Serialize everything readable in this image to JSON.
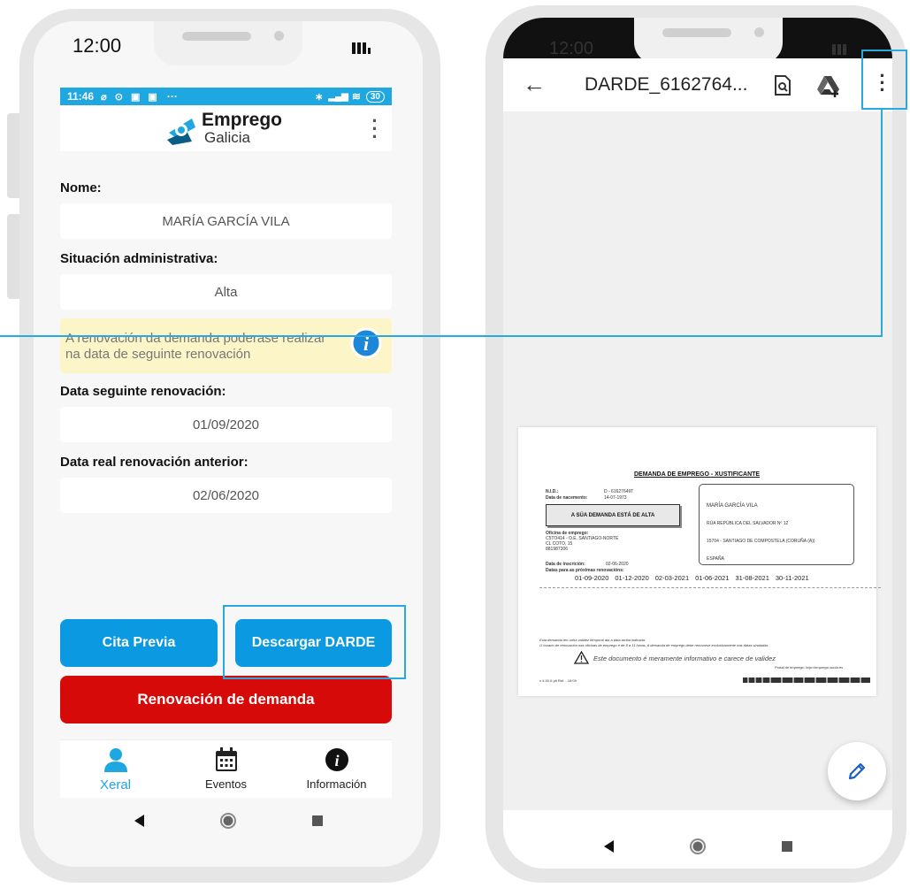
{
  "left": {
    "clock": "12:00",
    "status_bar": {
      "time": "11:46",
      "more": "···",
      "battery": "30"
    },
    "app": {
      "logo_line1": "Emprego",
      "logo_line2": "Galicia"
    },
    "fields": [
      {
        "label": "Nome:",
        "value": "MARÍA GARCÍA VILA"
      },
      {
        "label": "Situación administrativa:",
        "value": "Alta"
      },
      {
        "label": "Data seguinte renovación:",
        "value": "01/09/2020"
      },
      {
        "label": "Data real renovación anterior:",
        "value": "02/06/2020"
      }
    ],
    "info_message": "A renovación da demanda poderase realizar na data de seguinte renovación",
    "buttons": {
      "cita": "Cita Previa",
      "darde": "Descargar DARDE",
      "renovacion": "Renovación de demanda"
    },
    "nav": [
      {
        "label": "Xeral",
        "icon": "person-icon",
        "active": true
      },
      {
        "label": "Eventos",
        "icon": "calendar-icon",
        "active": false
      },
      {
        "label": "Información",
        "icon": "info-icon",
        "active": false
      }
    ]
  },
  "right": {
    "clock": "12:00",
    "file_title": "DARDE_6162764...",
    "document": {
      "title": "DEMANDA DE EMPREGO - XUSTIFICANTE",
      "nif_label": "N.I.D.:",
      "nif_value": "D - 61627649T",
      "birth_label": "Data de nacemento:",
      "birth_value": "14-07-1973",
      "status_box": "A SÚA DEMANDA ESTÁ DE ALTA",
      "office_label": "Oficina de emprego:",
      "office_lines": [
        "C5TO414 - O.E. SANTIAGO-NORTE",
        "CL COTO, 15",
        "881987306"
      ],
      "address": [
        "MARÍA GARCÍA VILA",
        "RÚA REPÚBLICA DEL SALVADOR Nº 12",
        "15704 - SANTIAGO DE COMPOSTELA (CORUÑA (A))",
        "ESPAÑA"
      ],
      "inscription_label": "Data de inscrición:",
      "inscription_value": "02-06-2020",
      "renewals_label": "Datas para as próximas renovacións:",
      "renewal_dates": [
        "01-09-2020",
        "01-12-2020",
        "02-03-2021",
        "01-06-2021",
        "31-08-2021",
        "30-11-2021"
      ],
      "note1": "Esta demanda ten unha validez temporal ata a data arriba indicada.",
      "note2": "O horario de renovación nas oficinas de emprego é de 8 a 11 horas. A demanda de emprego debe renovarse exclusivamente nas datas sinaladas",
      "disclaimer": "Este documento é meramente informativo e carece de validez",
      "disclaimer_right": "Portal de emprego: http://emprego.xunta.es",
      "footer_left": "v 4.00.0-pit   Ref. - 16:09"
    }
  },
  "colors": {
    "accent_blue": "#1fa7e1",
    "button_blue": "#0b9ae2",
    "renew_red": "#d70a0a",
    "info_bg": "#fbf5c8",
    "highlight": "#2aa8e0"
  }
}
